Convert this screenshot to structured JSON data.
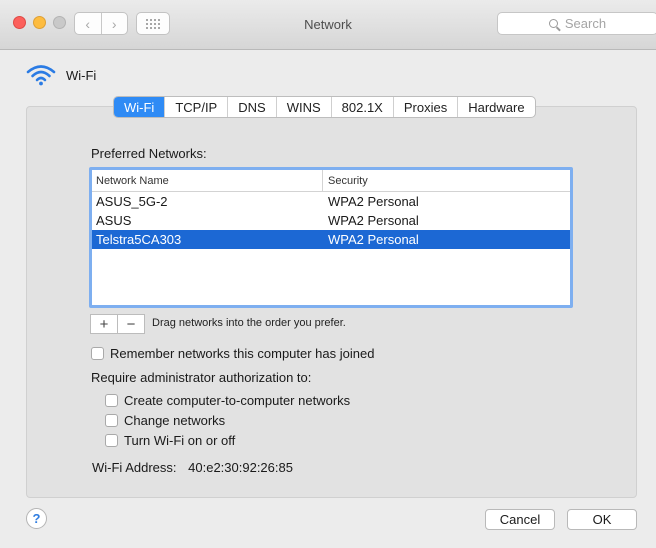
{
  "window": {
    "title": "Network",
    "search_placeholder": "Search",
    "back_glyph": "‹",
    "forward_glyph": "›"
  },
  "header": {
    "label": "Wi-Fi",
    "icon": "wifi-icon"
  },
  "tabs": [
    {
      "label": "Wi-Fi",
      "active": true
    },
    {
      "label": "TCP/IP"
    },
    {
      "label": "DNS"
    },
    {
      "label": "WINS"
    },
    {
      "label": "802.1X"
    },
    {
      "label": "Proxies"
    },
    {
      "label": "Hardware"
    }
  ],
  "preferred": {
    "label": "Preferred Networks:",
    "columns": [
      "Network Name",
      "Security"
    ],
    "rows": [
      {
        "name": "ASUS_5G-2",
        "security": "WPA2 Personal"
      },
      {
        "name": "ASUS",
        "security": "WPA2 Personal"
      },
      {
        "name": "Telstra5CA303",
        "security": "WPA2 Personal",
        "selected": true
      }
    ],
    "add_glyph": "+",
    "remove_glyph": "−",
    "drag_hint": "Drag networks into the order you prefer."
  },
  "options": {
    "remember": "Remember networks this computer has joined",
    "require_label": "Require administrator authorization to:",
    "create": "Create computer-to-computer networks",
    "change": "Change networks",
    "turn": "Turn Wi-Fi on or off"
  },
  "address": {
    "label": "Wi-Fi Address:",
    "value": "40:e2:30:92:26:85"
  },
  "footer": {
    "help": "?",
    "cancel": "Cancel",
    "ok": "OK"
  },
  "colors": {
    "accent": "#2f8bf5",
    "selection": "#1c68d4",
    "wifi": "#2a7be4"
  }
}
